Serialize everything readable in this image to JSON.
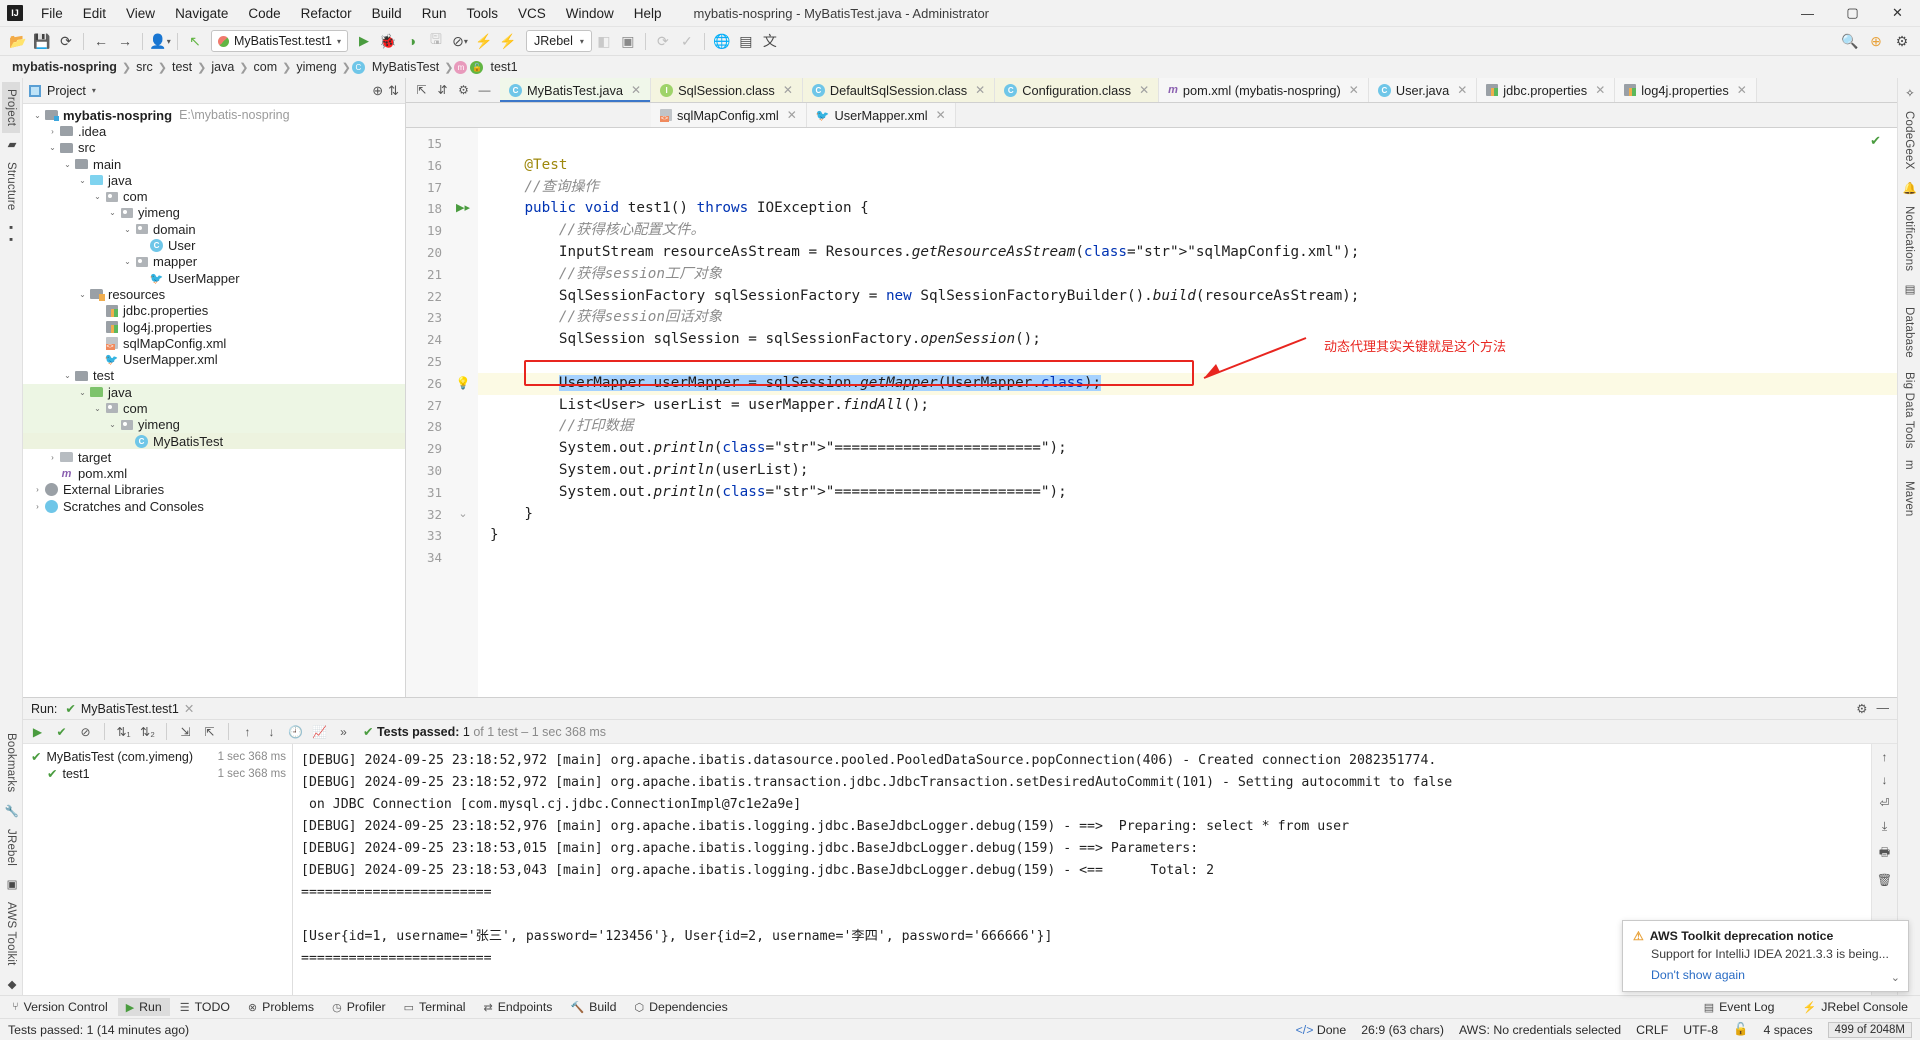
{
  "titlebar": {
    "logo": "IJ",
    "menus": [
      "File",
      "Edit",
      "View",
      "Navigate",
      "Code",
      "Refactor",
      "Build",
      "Run",
      "Tools",
      "VCS",
      "Window",
      "Help"
    ],
    "window_title": "mybatis-nospring - MyBatisTest.java - Administrator",
    "minimize": "—",
    "maximize": "▢",
    "close": "✕"
  },
  "toolbar": {
    "run_config": "MyBatisTest.test1",
    "plugin": "JRebel"
  },
  "breadcrumb": {
    "items": [
      "mybatis-nospring",
      "src",
      "test",
      "java",
      "com",
      "yimeng",
      "MyBatisTest",
      "test1"
    ]
  },
  "left_rail": {
    "tabs": [
      "Project",
      "Structure"
    ]
  },
  "right_rail": {
    "tabs": [
      "CodeGeeX",
      "Notifications",
      "Database",
      "Big Data Tools",
      "Maven"
    ]
  },
  "bottom_left_rail": {
    "tabs": [
      "Bookmarks",
      "JRebel",
      "AWS Toolkit"
    ]
  },
  "project": {
    "header": "Project",
    "tree": [
      {
        "depth": 0,
        "arrow": "down",
        "icon": "module",
        "label": "mybatis-nospring",
        "bold": true,
        "path": "E:\\mybatis-nospring",
        "hl": false
      },
      {
        "depth": 1,
        "arrow": "right",
        "icon": "folder",
        "label": ".idea",
        "hl": false
      },
      {
        "depth": 1,
        "arrow": "down",
        "icon": "folder",
        "label": "src",
        "hl": false
      },
      {
        "depth": 2,
        "arrow": "down",
        "icon": "folder",
        "label": "main",
        "hl": false
      },
      {
        "depth": 3,
        "arrow": "down",
        "icon": "src-folder",
        "label": "java",
        "hl": false
      },
      {
        "depth": 4,
        "arrow": "down",
        "icon": "package",
        "label": "com",
        "hl": false
      },
      {
        "depth": 5,
        "arrow": "down",
        "icon": "package",
        "label": "yimeng",
        "hl": false
      },
      {
        "depth": 6,
        "arrow": "down",
        "icon": "package",
        "label": "domain",
        "hl": false
      },
      {
        "depth": 7,
        "arrow": "none",
        "icon": "class",
        "label": "User",
        "hl": false
      },
      {
        "depth": 6,
        "arrow": "down",
        "icon": "package",
        "label": "mapper",
        "hl": false
      },
      {
        "depth": 7,
        "arrow": "none",
        "icon": "mybatis",
        "label": "UserMapper",
        "hl": false
      },
      {
        "depth": 3,
        "arrow": "down",
        "icon": "res-folder",
        "label": "resources",
        "hl": false
      },
      {
        "depth": 4,
        "arrow": "none",
        "icon": "properties",
        "label": "jdbc.properties",
        "hl": false
      },
      {
        "depth": 4,
        "arrow": "none",
        "icon": "properties",
        "label": "log4j.properties",
        "hl": false
      },
      {
        "depth": 4,
        "arrow": "none",
        "icon": "xml",
        "label": "sqlMapConfig.xml",
        "hl": false
      },
      {
        "depth": 4,
        "arrow": "none",
        "icon": "mybatis",
        "label": "UserMapper.xml",
        "hl": false
      },
      {
        "depth": 2,
        "arrow": "down",
        "icon": "folder",
        "label": "test",
        "hl": false
      },
      {
        "depth": 3,
        "arrow": "down",
        "icon": "test-folder",
        "label": "java",
        "hl": true
      },
      {
        "depth": 4,
        "arrow": "down",
        "icon": "package",
        "label": "com",
        "hl": true
      },
      {
        "depth": 5,
        "arrow": "down",
        "icon": "package",
        "label": "yimeng",
        "hl": true
      },
      {
        "depth": 6,
        "arrow": "none",
        "icon": "test-class",
        "label": "MyBatisTest",
        "hl": true,
        "sel": true
      },
      {
        "depth": 1,
        "arrow": "right",
        "icon": "target-folder",
        "label": "target",
        "hl": false
      },
      {
        "depth": 1,
        "arrow": "none",
        "icon": "maven",
        "label": "pom.xml",
        "hl": false
      },
      {
        "depth": 0,
        "arrow": "right",
        "icon": "library",
        "label": "External Libraries",
        "hl": false
      },
      {
        "depth": 0,
        "arrow": "right",
        "icon": "scratch",
        "label": "Scratches and Consoles",
        "hl": false
      }
    ]
  },
  "editor": {
    "tabs_row1": [
      {
        "label": "MyBatisTest.java",
        "icon": "test-class",
        "active": true
      },
      {
        "label": "SqlSession.class",
        "icon": "interface",
        "active": false,
        "tone": "yellow"
      },
      {
        "label": "DefaultSqlSession.class",
        "icon": "class",
        "active": false,
        "tone": "yellow"
      },
      {
        "label": "Configuration.class",
        "icon": "class",
        "active": false,
        "tone": "yellow"
      },
      {
        "label": "pom.xml (mybatis-nospring)",
        "icon": "maven",
        "active": false
      },
      {
        "label": "User.java",
        "icon": "class",
        "active": false
      },
      {
        "label": "jdbc.properties",
        "icon": "properties",
        "active": false
      },
      {
        "label": "log4j.properties",
        "icon": "properties",
        "active": false
      }
    ],
    "tabs_row2": [
      {
        "label": "sqlMapConfig.xml",
        "icon": "xml"
      },
      {
        "label": "UserMapper.xml",
        "icon": "mybatis"
      }
    ],
    "first_line_number": 15,
    "lines": [
      {
        "n": 15,
        "text": ""
      },
      {
        "n": 16,
        "text": "    @Test",
        "type": "annotation"
      },
      {
        "n": 17,
        "text": "    //查询操作",
        "type": "comment"
      },
      {
        "n": 18,
        "text": "    public void test1() throws IOException {",
        "type": "code",
        "runmark": true,
        "fold": true
      },
      {
        "n": 19,
        "text": "        //获得核心配置文件。",
        "type": "comment"
      },
      {
        "n": 20,
        "text": "        InputStream resourceAsStream = Resources.getResourceAsStream(\"sqlMapConfig.xml\");",
        "type": "code"
      },
      {
        "n": 21,
        "text": "        //获得session工厂对象",
        "type": "comment"
      },
      {
        "n": 22,
        "text": "        SqlSessionFactory sqlSessionFactory = new SqlSessionFactoryBuilder().build(resourceAsStream);",
        "type": "code"
      },
      {
        "n": 23,
        "text": "        //获得session回话对象",
        "type": "comment"
      },
      {
        "n": 24,
        "text": "        SqlSession sqlSession = sqlSessionFactory.openSession();",
        "type": "code"
      },
      {
        "n": 25,
        "text": "",
        "type": "code"
      },
      {
        "n": 26,
        "text": "        UserMapper userMapper = sqlSession.getMapper(UserMapper.class);",
        "type": "highlighted",
        "bulb": true
      },
      {
        "n": 27,
        "text": "        List<User> userList = userMapper.findAll();",
        "type": "code"
      },
      {
        "n": 28,
        "text": "        //打印数据",
        "type": "comment"
      },
      {
        "n": 29,
        "text": "        System.out.println(\"========================\");",
        "type": "code"
      },
      {
        "n": 30,
        "text": "        System.out.println(userList);",
        "type": "code"
      },
      {
        "n": 31,
        "text": "        System.out.println(\"========================\");",
        "type": "code"
      },
      {
        "n": 32,
        "text": "    }",
        "type": "code",
        "fold": true
      },
      {
        "n": 33,
        "text": "}",
        "type": "code"
      },
      {
        "n": 34,
        "text": "",
        "type": "code"
      }
    ],
    "annotation_note": "动态代理其实关键就是这个方法"
  },
  "run_panel": {
    "label": "Run:",
    "tab": "MyBatisTest.test1",
    "status_passed": "Tests passed:",
    "status_count": "1",
    "status_of": "of 1 test – 1 sec 368 ms",
    "tests": [
      {
        "label": "MyBatisTest (com.yimeng)",
        "time": "1 sec 368 ms",
        "indent": 0
      },
      {
        "label": "test1",
        "time": "1 sec 368 ms",
        "indent": 1
      }
    ],
    "console": [
      "[DEBUG] 2024-09-25 23:18:52,972 [main] org.apache.ibatis.datasource.pooled.PooledDataSource.popConnection(406) - Created connection 2082351774.",
      "[DEBUG] 2024-09-25 23:18:52,972 [main] org.apache.ibatis.transaction.jdbc.JdbcTransaction.setDesiredAutoCommit(101) - Setting autocommit to false",
      " on JDBC Connection [com.mysql.cj.jdbc.ConnectionImpl@7c1e2a9e]",
      "[DEBUG] 2024-09-25 23:18:52,976 [main] org.apache.ibatis.logging.jdbc.BaseJdbcLogger.debug(159) - ==>  Preparing: select * from user",
      "[DEBUG] 2024-09-25 23:18:53,015 [main] org.apache.ibatis.logging.jdbc.BaseJdbcLogger.debug(159) - ==> Parameters:",
      "[DEBUG] 2024-09-25 23:18:53,043 [main] org.apache.ibatis.logging.jdbc.BaseJdbcLogger.debug(159) - <==      Total: 2",
      "========================",
      "",
      "[User{id=1, username='张三', password='123456'}, User{id=2, username='李四', password='666666'}]",
      "========================"
    ]
  },
  "toast": {
    "title": "AWS Toolkit deprecation notice",
    "body": "Support for IntelliJ IDEA 2021.3.3 is being...",
    "link": "Don't show again"
  },
  "bottom_tabs": [
    {
      "label": "Version Control",
      "icon": "branch"
    },
    {
      "label": "Run",
      "icon": "play",
      "selected": true
    },
    {
      "label": "TODO",
      "icon": "list"
    },
    {
      "label": "Problems",
      "icon": "warn"
    },
    {
      "label": "Profiler",
      "icon": "gauge"
    },
    {
      "label": "Terminal",
      "icon": "term"
    },
    {
      "label": "Endpoints",
      "icon": "endpoint"
    },
    {
      "label": "Build",
      "icon": "hammer"
    },
    {
      "label": "Dependencies",
      "icon": "deps"
    }
  ],
  "bottom_right": [
    {
      "label": "Event Log",
      "icon": "log"
    },
    {
      "label": "JRebel Console",
      "icon": "jrebel"
    }
  ],
  "statusbar": {
    "left": "Tests passed: 1 (14 minutes ago)",
    "done": "Done",
    "caret": "26:9 (63 chars)",
    "aws": "AWS: No credentials selected",
    "line_sep": "CRLF",
    "encoding": "UTF-8",
    "indent": "4 spaces",
    "memory": "499 of 2048M"
  },
  "colors": {
    "accent_blue": "#3c77c9",
    "green": "#62b543",
    "red": "#e8251f",
    "selection": "#a6d2ff",
    "highlight_line": "#fcfae4"
  }
}
